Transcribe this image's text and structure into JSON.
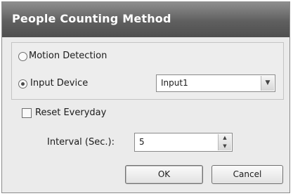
{
  "dialog": {
    "title": "People Counting Method",
    "method_options": [
      {
        "label": "Motion Detection",
        "selected": false
      },
      {
        "label": "Input Device",
        "selected": true
      }
    ],
    "input_device": {
      "value": "Input1"
    },
    "reset_everyday": {
      "label": "Reset Everyday",
      "checked": false
    },
    "interval": {
      "label": "Interval (Sec.):",
      "value": "5"
    },
    "buttons": {
      "ok": "OK",
      "cancel": "Cancel"
    }
  }
}
